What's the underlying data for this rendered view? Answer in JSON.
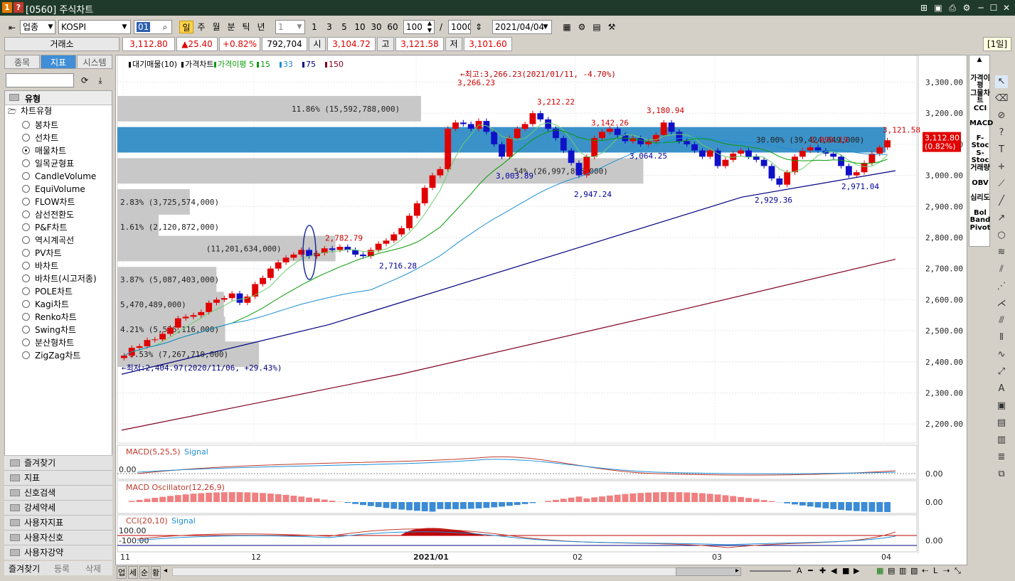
{
  "window": {
    "badges": [
      "1",
      "?"
    ],
    "title": "[0560] 주식차트"
  },
  "toolbar": {
    "market": "업종",
    "index": "KOSPI",
    "code": "01",
    "periods": [
      "일",
      "주",
      "월",
      "분",
      "틱",
      "년"
    ],
    "active_period": "일",
    "interval": "1",
    "quick_intervals": [
      "1",
      "3",
      "5",
      "10",
      "30",
      "60"
    ],
    "count": "100",
    "total": "1000",
    "date": "2021/04/04"
  },
  "quote": {
    "exchange_label": "거래소",
    "last": "3,112.80",
    "change": "▲25.40",
    "change_pct": "+0.82%",
    "volume": "792,704",
    "open_label": "시",
    "open": "3,104.72",
    "high_label": "고",
    "high": "3,121.58",
    "low_label": "저",
    "low": "3,101.60",
    "period_badge": "[1일]"
  },
  "left_panel": {
    "tabs": [
      "종목",
      "지표",
      "시스템"
    ],
    "active_tab": "지표",
    "section": "유형",
    "subsection": "차트유형",
    "types": [
      "봉차트",
      "선차트",
      "매물차트",
      "일목균형표",
      "CandleVolume",
      "EquiVolume",
      "FLOW차트",
      "삼선전환도",
      "P&F차트",
      "역시계곡선",
      "PV차트",
      "바차트",
      "바차트(시고저종)",
      "POLE차트",
      "Kagi차트",
      "Renko차트",
      "Swing차트",
      "분산형차트",
      "ZigZag차트"
    ],
    "selected_type": "매물차트",
    "folders": [
      "즐겨찾기",
      "지표",
      "신호검색",
      "강세약세",
      "사용자지표",
      "사용자신호",
      "사용자강약"
    ],
    "bottom_tabs": [
      "즐겨찾기",
      "등록",
      "삭제"
    ]
  },
  "chart_data": {
    "type": "candlestick",
    "legend": [
      "대기매물(10)",
      "가격차트",
      "가격이평 5",
      "15",
      "33",
      "75",
      "150"
    ],
    "legend_colors": [
      "#000000",
      "#000000",
      "#0a9a0a",
      "#0a9a0a",
      "#1d8fd6",
      "#000080",
      "#800020"
    ],
    "y_ticks": [
      "3,300.00",
      "3,200.00",
      "3,100.00",
      "3,000.00",
      "2,900.00",
      "2,800.00",
      "2,700.00",
      "2,600.00",
      "2,500.00",
      "2,400.00",
      "2,300.00",
      "2,200.00"
    ],
    "ylim": [
      2150,
      3340
    ],
    "x_labels": [
      "11",
      "12",
      "2021/01",
      "02",
      "03",
      "04"
    ],
    "last_price_label": "3,112.80",
    "last_pct_label": "(0.82%)",
    "max_annotation": "←최고:3,266.23(2021/01/11, -4.70%)",
    "min_annotation": "←최저:2,404.97(2020/11/06, +29.43%)",
    "price_labels": [
      {
        "t": "3,266.23",
        "c": "red"
      },
      {
        "t": "3,212.22",
        "c": "red"
      },
      {
        "t": "3,142.26",
        "c": "red"
      },
      {
        "t": "3,180.94",
        "c": "red"
      },
      {
        "t": "3,090.19",
        "c": "red"
      },
      {
        "t": "3,121.58",
        "c": "red"
      },
      {
        "t": "2,782.79",
        "c": "red"
      },
      {
        "t": "3,003.89",
        "c": "blue"
      },
      {
        "t": "2,947.24",
        "c": "blue"
      },
      {
        "t": "3,064.25",
        "c": "blue"
      },
      {
        "t": "2,929.36",
        "c": "blue"
      },
      {
        "t": "2,971.04",
        "c": "blue"
      },
      {
        "t": "2,716.28",
        "c": "blue"
      }
    ],
    "volume_profile": [
      {
        "level": 3210,
        "label": "11.86% (15,592,788,000)",
        "pct": 11.86
      },
      {
        "level": 3110,
        "label": "30.00% (39,424,649,000)",
        "pct": 30.0
      },
      {
        "level": 3010,
        "label": "54% (26,997,896,000)",
        "pct": 20.54
      },
      {
        "level": 2910,
        "label": "2.83% (3,725,574,000)",
        "pct": 2.83
      },
      {
        "level": 2830,
        "label": "1.61% (2,120,872,000)",
        "pct": 1.61
      },
      {
        "level": 2760,
        "label": "(11,201,634,000)",
        "pct": 8.52
      },
      {
        "level": 2660,
        "label": "3.87% (5,087,403,000)",
        "pct": 3.87
      },
      {
        "level": 2580,
        "label": "5,470,489,000)",
        "pct": 4.16
      },
      {
        "level": 2500,
        "label": "4.21% (5,536,116,000)",
        "pct": 4.21
      },
      {
        "level": 2420,
        "label": "5.53% (7,267,710,000)",
        "pct": 5.53
      }
    ],
    "closes": [
      2420,
      2445,
      2450,
      2470,
      2472,
      2490,
      2510,
      2540,
      2545,
      2550,
      2560,
      2590,
      2600,
      2605,
      2620,
      2590,
      2610,
      2650,
      2670,
      2700,
      2720,
      2735,
      2745,
      2760,
      2740,
      2750,
      2765,
      2760,
      2770,
      2760,
      2745,
      2740,
      2760,
      2780,
      2790,
      2810,
      2830,
      2870,
      2910,
      2960,
      3000,
      3020,
      3150,
      3170,
      3165,
      3150,
      3175,
      3140,
      3100,
      3060,
      3120,
      3150,
      3165,
      3200,
      3180,
      3150,
      3120,
      3080,
      3040,
      3000,
      3060,
      3120,
      3140,
      3150,
      3130,
      3110,
      3120,
      3100,
      3110,
      3130,
      3170,
      3140,
      3110,
      3100,
      3080,
      3060,
      3080,
      3030,
      3050,
      3070,
      3080,
      3060,
      3050,
      3030,
      2990,
      2970,
      3010,
      3060,
      3080,
      3090,
      3080,
      3070,
      3060,
      3030,
      3000,
      3010,
      3040,
      3070,
      3090,
      3112.8
    ]
  },
  "macd_panel": {
    "title": "MACD(5,25,5)",
    "signal": "Signal",
    "left_value": "0.00",
    "axis": "0.00"
  },
  "osc_panel": {
    "title": "MACD Oscillator(12,26,9)",
    "axis": "0.00"
  },
  "cci_panel": {
    "title": "CCI(20,10)",
    "signal": "Signal",
    "upper": "100.00",
    "lower": "-100.00",
    "axis": "0.00"
  },
  "right_indicators": [
    "가격이평",
    "그물차트",
    "CCI",
    "MACD",
    "F-Stoc",
    "S-Stoc",
    "거래량",
    "OBV",
    "심리도",
    "Bol Band",
    "Pivot"
  ],
  "bottom_bar": {
    "buttons": [
      "업",
      "세",
      "순",
      "황"
    ]
  }
}
